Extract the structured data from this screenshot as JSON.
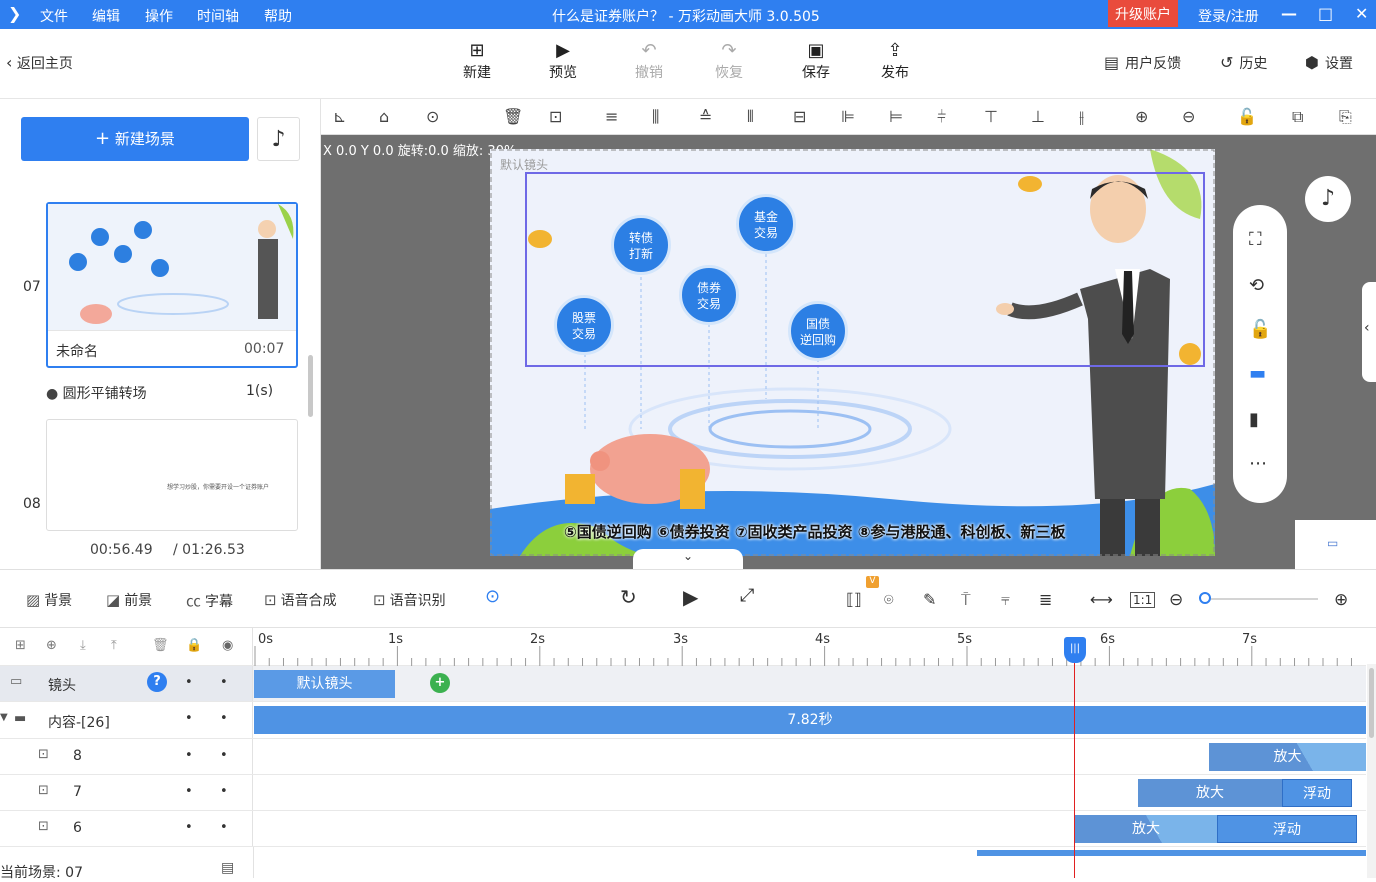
{
  "app": {
    "logo_icon": "app-logo-icon",
    "menu": [
      "文件",
      "编辑",
      "操作",
      "时间轴",
      "帮助"
    ],
    "title": "什么是证券账户？ - 万彩动画大师 3.0.505",
    "upgrade": "升级账户",
    "login": "登录/注册",
    "win_min": "—",
    "win_max": "□",
    "win_close": "✕"
  },
  "toolbar": {
    "back": "返回主页",
    "new": "新建",
    "preview": "预览",
    "undo": "撤销",
    "redo": "恢复",
    "save": "保存",
    "publish": "发布",
    "feedback": "用户反馈",
    "history": "历史",
    "settings": "设置"
  },
  "leftpanel": {
    "new_scene": "新建场景",
    "scene07": {
      "num": "07",
      "name": "未命名",
      "duration": "00:07"
    },
    "transition": {
      "name": "圆形平铺转场",
      "duration": "1(s)"
    },
    "scene08": {
      "num": "08",
      "caption": "想学习炒股，你需要开设一个证券账户"
    },
    "time_current": "00:56.49",
    "time_total": "/ 01:26.53"
  },
  "canvas": {
    "coords": "X 0.0  Y 0.0  旋转:0.0  缩放: 30%",
    "camera_label": "默认镜头",
    "bubbles": [
      "股票\n交易",
      "转债\n打新",
      "债券\n交易",
      "基金\n交易",
      "国债\n逆回购"
    ],
    "subtitle": "⑤国债逆回购 ⑥债券投资 ⑦固收类产品投资 ⑧参与港股通、科创板、新三板"
  },
  "timeline_tools": {
    "background": "背景",
    "foreground": "前景",
    "caption": "字幕",
    "tts": "语音合成",
    "asr": "语音识别",
    "vip_badge": "V"
  },
  "timeline": {
    "ticks": [
      "0s",
      "1s",
      "2s",
      "3s",
      "4s",
      "5s",
      "6s",
      "7s"
    ],
    "camera_row": "镜头",
    "camera_clip": "默认镜头",
    "content_row": "内容-[26]",
    "content_clip": "7.82秒",
    "rows": [
      {
        "label": "8",
        "clips": [
          "放大"
        ]
      },
      {
        "label": "7",
        "clips": [
          "放大",
          "浮动"
        ]
      },
      {
        "label": "6",
        "clips": [
          "放大",
          "浮动"
        ]
      }
    ],
    "current_scene": "当前场景: 07"
  }
}
